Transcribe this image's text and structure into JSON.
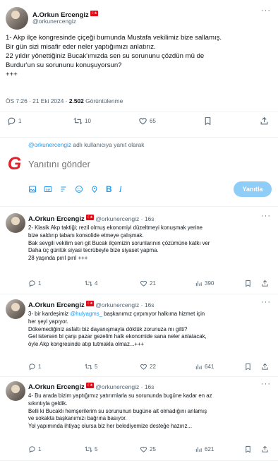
{
  "main_tweet": {
    "name": "A.Orkun Ercengiz",
    "handle": "@orkunercengiz",
    "lines": [
      "1- Akp ilçe kongresinde çiçeği burnunda Mustafa vekilimiz bize sallamış.",
      "Bir gün sizi misafir eder neler yaptığımızı anlatırız.",
      "22 yıldır yönettiğiniz Bucak'ımızda sen su sorununu çözdün mü de",
      "Burdur'un su sorununu konuşuyorsun?",
      "+++"
    ],
    "time": "ÖS 7:26 · 21 Eki 2024 · ",
    "views_count": "2.502",
    "views_label": " Görüntülenme",
    "replies": "1",
    "retweets": "10",
    "likes": "65"
  },
  "reply_box": {
    "replying_to_handle": "@orkunercengiz",
    "replying_to_suffix": " adlı kullanıcıya yanıt olarak",
    "placeholder": "Yanıtını gönder",
    "submit_label": "Yanıtla"
  },
  "thread": [
    {
      "name": "A.Orkun Ercengiz",
      "handle": "@orkunercengiz",
      "time": "16s",
      "lines": [
        "2- Klasik Akp taktiği; rezil olmuş ekonomiyi düzeltmeyi konuşmak yerine",
        "bize saldırıp tabanı konsolide etmeye çalışmak.",
        "Bak sevgili vekilim sen git Bucak ilçemizin sorunlarının çözümüne katkı ver",
        "Daha üç günlük siyasi tecrübeyle bize siyaset yapma.",
        "28 yaşında pırıl pırıl +++"
      ],
      "replies": "1",
      "retweets": "4",
      "likes": "21",
      "views": "390"
    },
    {
      "name": "A.Orkun Ercengiz",
      "handle": "@orkunercengiz",
      "time": "16s",
      "line1_pre": "3- bir kardeşimiz ",
      "line1_mention": "@hulyagms_",
      "line1_post": "  başkanımız çırpınıyor halkıma hizmet için",
      "lines": [
        "her şeyi yapıyor.",
        "Dökemediğiniz asfaltı biz dayanışmayla döktük zorunuza mı gitti?",
        "Gel istersen bi çarşı pazar gezelim halk ekonomide sana neler anlatacak,",
        "öyle Akp kongresinde atıp tutmakla olmaz...+++"
      ],
      "replies": "1",
      "retweets": "5",
      "likes": "22",
      "views": "641"
    },
    {
      "name": "A.Orkun Ercengiz",
      "handle": "@orkunercengiz",
      "time": "16s",
      "lines": [
        "4- Bu arada bizim yaptığımız yatırımlarla su sorununda bugüne kadar en az",
        "sıkıntıyla geldik.",
        "Belli ki Bucaklı hemşerilerim su sorununun bugüne ait olmadığını anlamış",
        "ve sokakta başkanımızı bağrına basıyor.",
        "Yol yapımında ihtiyaç olursa biz her belediyemize desteğe hazırız..."
      ],
      "replies": "1",
      "retweets": "5",
      "likes": "25",
      "views": "621"
    }
  ],
  "colors": {
    "accent": "#1d9bf0",
    "reply_button": "#8ecdf7",
    "muted": "#536471",
    "logo_red": "#e4202a"
  }
}
